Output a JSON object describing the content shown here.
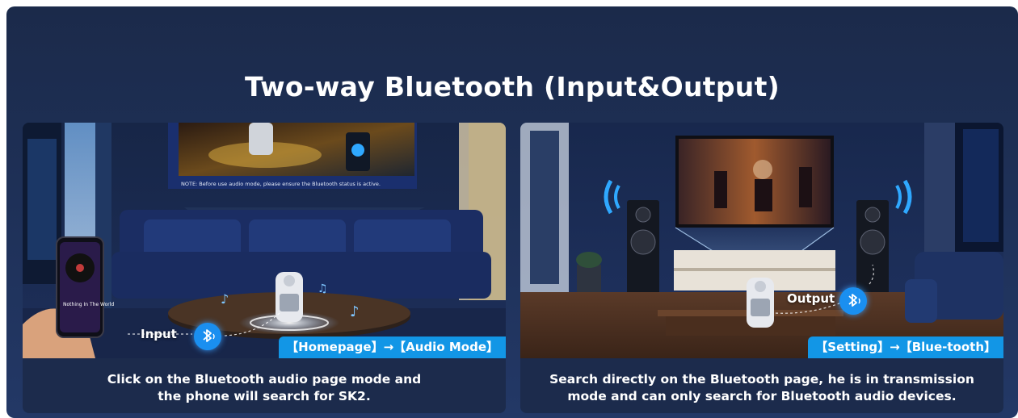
{
  "title": "Two-way Bluetooth (Input&Output)",
  "left_panel": {
    "note": "NOTE: Before use audio mode, please ensure the Bluetooth status is active.",
    "input_label": "Input",
    "tag": "【Homepage】→【Audio Mode】",
    "caption_line1": "Click on the Bluetooth audio page mode and",
    "caption_line2": "the phone will search for SK2.",
    "phone_song": "Nothing In The World"
  },
  "right_panel": {
    "output_label": "Output",
    "tag": "【Setting】→【Blue-tooth】",
    "caption_line1": "Search directly on the Bluetooth page, he is in transmission",
    "caption_line2": "mode and can only search for Bluetooth audio devices."
  },
  "colors": {
    "background": "#1e3057",
    "tag_blue": "#1296e6",
    "bluetooth_blue": "#1a8ff0"
  },
  "icons": [
    "bluetooth-icon",
    "music-note-icon",
    "speaker-icon",
    "projector-icon",
    "phone-icon"
  ]
}
